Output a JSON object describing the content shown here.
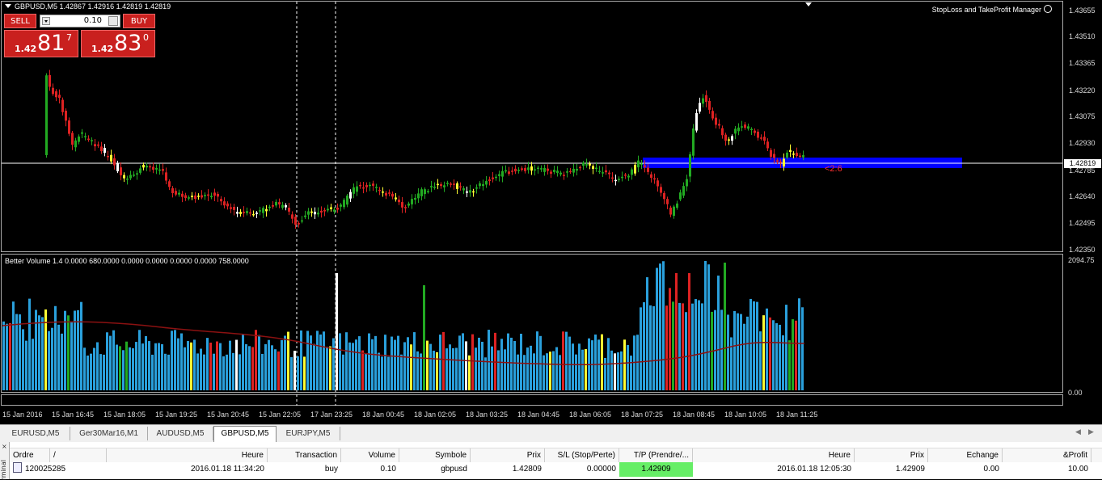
{
  "chart": {
    "symbol_title": "GBPUSD,M5  1.42867 1.42916 1.42819 1.42819",
    "manager_label": "StopLoss and TakeProfit Manager",
    "current_price": "1.42819",
    "price_ticks": [
      "1.43655",
      "1.43510",
      "1.43365",
      "1.43220",
      "1.43075",
      "1.42930",
      "1.42785",
      "1.42640",
      "1.42495",
      "1.42350"
    ],
    "time_ticks": [
      "15 Jan 2016",
      "15 Jan 16:45",
      "15 Jan 18:05",
      "15 Jan 19:25",
      "15 Jan 20:45",
      "15 Jan 22:05",
      "17 Jan 23:25",
      "18 Jan 00:45",
      "18 Jan 02:05",
      "18 Jan 03:25",
      "18 Jan 04:45",
      "18 Jan 06:05",
      "18 Jan 07:25",
      "18 Jan 08:45",
      "18 Jan 10:05",
      "18 Jan 11:25"
    ],
    "annotation": "<2:6",
    "volume_title": "Better Volume 1.4 0.0000 680.0000 0.0000 0.0000 0.0000 0.0000 758.0000",
    "volume_max": "2094.75",
    "volume_min": "0.00",
    "colors": {
      "bull": "#22aa22",
      "bear": "#dd2222",
      "volume": "#2aa0dc",
      "ma": "#8b1111",
      "zone": "#0000ff"
    }
  },
  "oneclick": {
    "sell_label": "SELL",
    "buy_label": "BUY",
    "lot": "0.10",
    "sell_small": "1.42",
    "sell_big": "81",
    "sell_sup": "7",
    "buy_small": "1.42",
    "buy_big": "83",
    "buy_sup": "0"
  },
  "tabs": [
    "EURUSD,M5",
    "Ger30Mar16,M1",
    "AUDUSD,M5",
    "GBPUSD,M5",
    "EURJPY,M5"
  ],
  "active_tab": "GBPUSD,M5",
  "terminal": {
    "side_label": "rminal",
    "headers": [
      "Ordre",
      "/",
      "Heure",
      "Transaction",
      "Volume",
      "Symbole",
      "Prix",
      "S/L (Stop/Perte)",
      "T/P (Prendre/...",
      "Heure",
      "Prix",
      "Echange",
      "&Profit"
    ],
    "row": {
      "order": "120025285",
      "time": "2016.01.18 11:34:20",
      "type": "buy",
      "volume": "0.10",
      "symbol": "gbpusd",
      "price": "1.42809",
      "sl": "0.00000",
      "tp": "1.42909",
      "close_time": "2016.01.18 12:05:30",
      "close_price": "1.42909",
      "swap": "0.00",
      "profit": "10.00"
    }
  }
}
